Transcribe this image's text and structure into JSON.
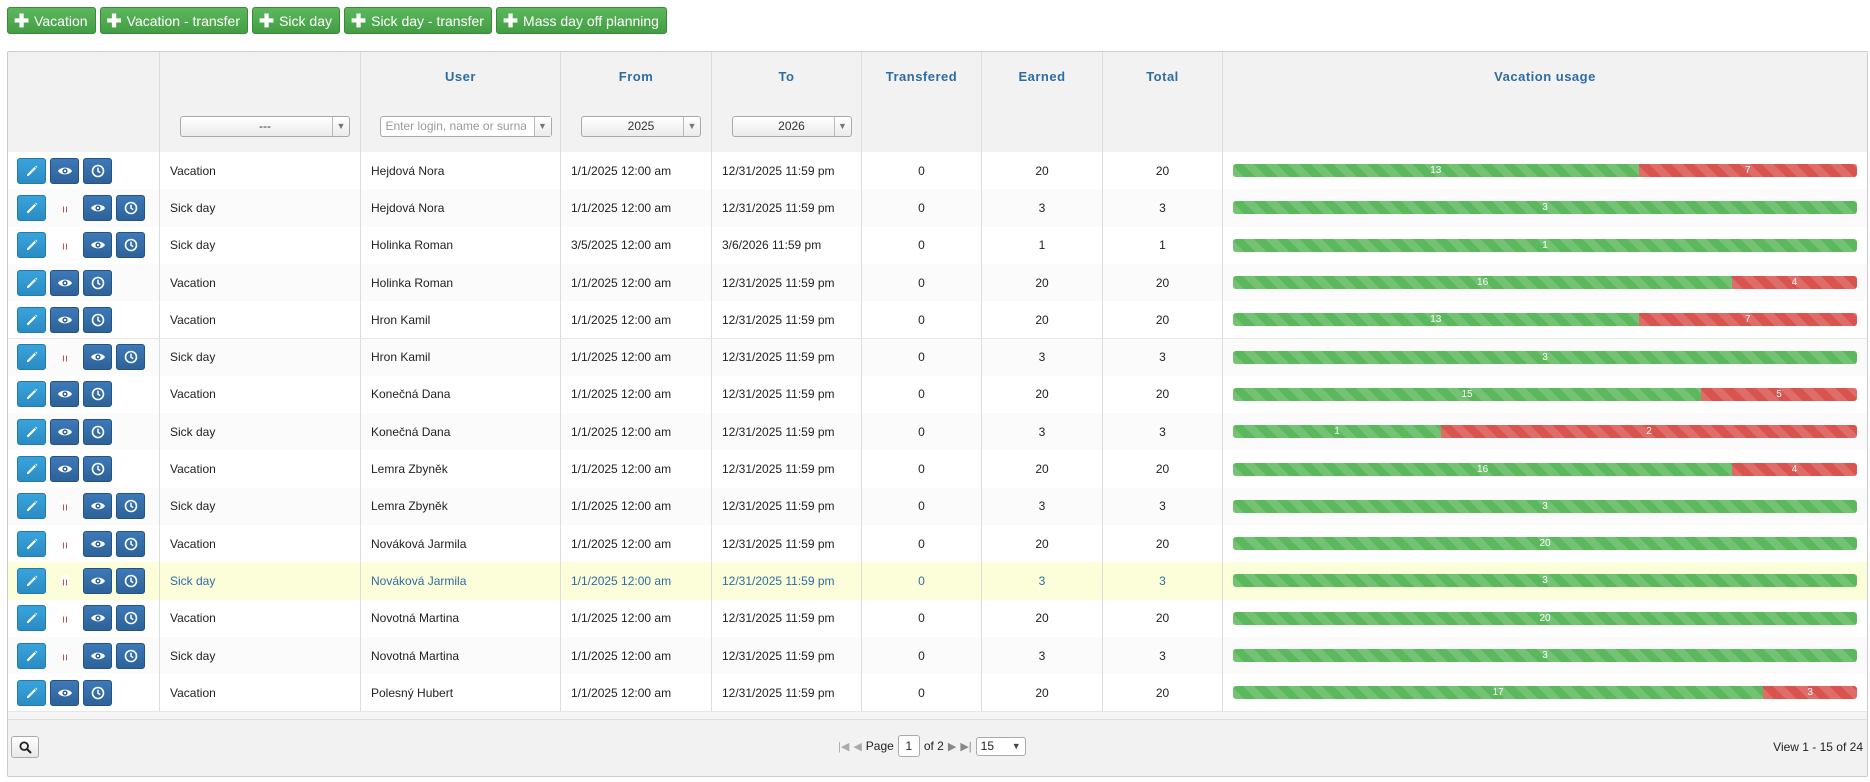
{
  "toolbar": {
    "buttons": [
      {
        "label": "Vacation"
      },
      {
        "label": "Vacation - transfer"
      },
      {
        "label": "Sick day"
      },
      {
        "label": "Sick day - transfer"
      },
      {
        "label": "Mass day off planning"
      }
    ]
  },
  "columns": {
    "actions": "",
    "type": "",
    "user": "User",
    "from": "From",
    "to": "To",
    "transfered": "Transfered",
    "earned": "Earned",
    "total": "Total",
    "usage": "Vacation usage"
  },
  "filters": {
    "type_value": "---",
    "user_placeholder": "Enter login, name or surname",
    "from_year": "2025",
    "to_year": "2026"
  },
  "rows": [
    {
      "actions": [
        "edit",
        "view",
        "history"
      ],
      "type": "Vacation",
      "user": "Hejdová Nora",
      "from": "1/1/2025 12:00 am",
      "to": "12/31/2025 11:59 pm",
      "transfered": "0",
      "earned": "20",
      "total": "20",
      "usage": {
        "free": 13,
        "used": 7
      }
    },
    {
      "actions": [
        "edit",
        "delete",
        "view",
        "history"
      ],
      "type": "Sick day",
      "user": "Hejdová Nora",
      "from": "1/1/2025 12:00 am",
      "to": "12/31/2025 11:59 pm",
      "transfered": "0",
      "earned": "3",
      "total": "3",
      "usage": {
        "free": 3,
        "used": 0
      }
    },
    {
      "actions": [
        "edit",
        "delete",
        "view",
        "history"
      ],
      "type": "Sick day",
      "user": "Holinka Roman",
      "from": "3/5/2025 12:00 am",
      "to": "3/6/2026 11:59 pm",
      "transfered": "0",
      "earned": "1",
      "total": "1",
      "usage": {
        "free": 1,
        "used": 0
      }
    },
    {
      "actions": [
        "edit",
        "view",
        "history"
      ],
      "type": "Vacation",
      "user": "Holinka Roman",
      "from": "1/1/2025 12:00 am",
      "to": "12/31/2025 11:59 pm",
      "transfered": "0",
      "earned": "20",
      "total": "20",
      "usage": {
        "free": 16,
        "used": 4
      }
    },
    {
      "actions": [
        "edit",
        "view",
        "history"
      ],
      "type": "Vacation",
      "user": "Hron Kamil",
      "from": "1/1/2025 12:00 am",
      "to": "12/31/2025 11:59 pm",
      "transfered": "0",
      "earned": "20",
      "total": "20",
      "usage": {
        "free": 13,
        "used": 7
      }
    },
    {
      "actions": [
        "edit",
        "delete",
        "view",
        "history"
      ],
      "type": "Sick day",
      "user": "Hron Kamil",
      "from": "1/1/2025 12:00 am",
      "to": "12/31/2025 11:59 pm",
      "transfered": "0",
      "earned": "3",
      "total": "3",
      "usage": {
        "free": 3,
        "used": 0
      }
    },
    {
      "actions": [
        "edit",
        "view",
        "history"
      ],
      "type": "Vacation",
      "user": "Konečná Dana",
      "from": "1/1/2025 12:00 am",
      "to": "12/31/2025 11:59 pm",
      "transfered": "0",
      "earned": "20",
      "total": "20",
      "usage": {
        "free": 15,
        "used": 5
      }
    },
    {
      "actions": [
        "edit",
        "view",
        "history"
      ],
      "type": "Sick day",
      "user": "Konečná Dana",
      "from": "1/1/2025 12:00 am",
      "to": "12/31/2025 11:59 pm",
      "transfered": "0",
      "earned": "3",
      "total": "3",
      "usage": {
        "free": 1,
        "used": 2
      }
    },
    {
      "actions": [
        "edit",
        "view",
        "history"
      ],
      "type": "Vacation",
      "user": "Lemra Zbyněk",
      "from": "1/1/2025 12:00 am",
      "to": "12/31/2025 11:59 pm",
      "transfered": "0",
      "earned": "20",
      "total": "20",
      "usage": {
        "free": 16,
        "used": 4
      }
    },
    {
      "actions": [
        "edit",
        "delete",
        "view",
        "history"
      ],
      "type": "Sick day",
      "user": "Lemra Zbyněk",
      "from": "1/1/2025 12:00 am",
      "to": "12/31/2025 11:59 pm",
      "transfered": "0",
      "earned": "3",
      "total": "3",
      "usage": {
        "free": 3,
        "used": 0
      }
    },
    {
      "actions": [
        "edit",
        "delete",
        "view",
        "history"
      ],
      "type": "Vacation",
      "user": "Nováková Jarmila",
      "from": "1/1/2025 12:00 am",
      "to": "12/31/2025 11:59 pm",
      "transfered": "0",
      "earned": "20",
      "total": "20",
      "usage": {
        "free": 20,
        "used": 0
      }
    },
    {
      "actions": [
        "edit",
        "delete",
        "view",
        "history"
      ],
      "type": "Sick day",
      "user": "Nováková Jarmila",
      "from": "1/1/2025 12:00 am",
      "to": "12/31/2025 11:59 pm",
      "transfered": "0",
      "earned": "3",
      "total": "3",
      "usage": {
        "free": 3,
        "used": 0
      },
      "highlighted": true
    },
    {
      "actions": [
        "edit",
        "delete",
        "view",
        "history"
      ],
      "type": "Vacation",
      "user": "Novotná Martina",
      "from": "1/1/2025 12:00 am",
      "to": "12/31/2025 11:59 pm",
      "transfered": "0",
      "earned": "20",
      "total": "20",
      "usage": {
        "free": 20,
        "used": 0
      }
    },
    {
      "actions": [
        "edit",
        "delete",
        "view",
        "history"
      ],
      "type": "Sick day",
      "user": "Novotná Martina",
      "from": "1/1/2025 12:00 am",
      "to": "12/31/2025 11:59 pm",
      "transfered": "0",
      "earned": "3",
      "total": "3",
      "usage": {
        "free": 3,
        "used": 0
      }
    },
    {
      "actions": [
        "edit",
        "view",
        "history"
      ],
      "type": "Vacation",
      "user": "Polesný Hubert",
      "from": "1/1/2025 12:00 am",
      "to": "12/31/2025 11:59 pm",
      "transfered": "0",
      "earned": "20",
      "total": "20",
      "usage": {
        "free": 17,
        "used": 3
      }
    }
  ],
  "pager": {
    "page_label": "Page",
    "page_value": "1",
    "of_label": "of 2",
    "rows_per_page": "15",
    "view_info": "View 1 - 15 of 24"
  },
  "colors": {
    "primary_green": "#5cb85c",
    "used_red": "#d9534f",
    "header_text": "#2e6da4",
    "highlight_row": "#fcfdd9"
  }
}
